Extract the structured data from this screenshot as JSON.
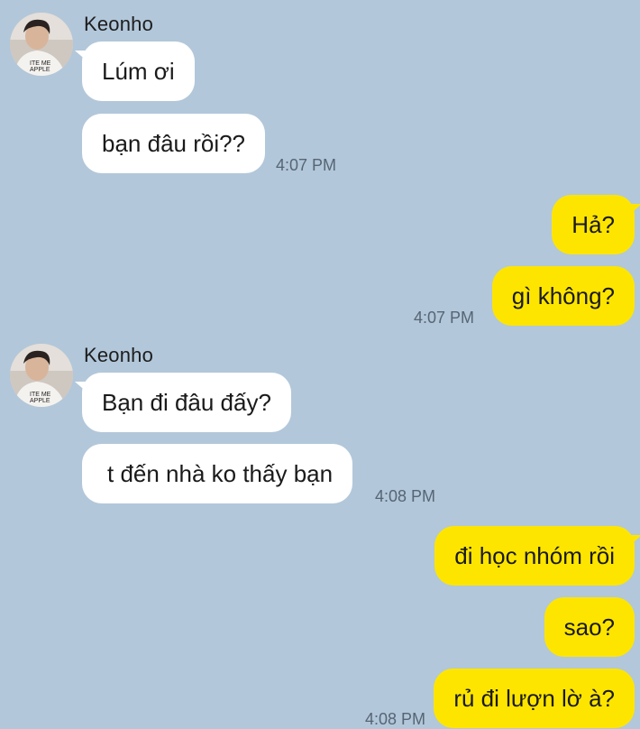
{
  "conversation": {
    "groups": [
      {
        "direction": "incoming",
        "sender": "Keonho",
        "avatar_icon": "profile-photo-icon",
        "messages": [
          "Lúm ơi",
          "bạn đâu rồi??"
        ],
        "time": "4:07 PM"
      },
      {
        "direction": "outgoing",
        "messages": [
          "Hả?",
          "gì không?"
        ],
        "time": "4:07 PM"
      },
      {
        "direction": "incoming",
        "sender": "Keonho",
        "avatar_icon": "profile-photo-icon",
        "messages": [
          "Bạn đi đâu đấy?",
          "t đến nhà ko thấy bạn"
        ],
        "time": "4:08 PM"
      },
      {
        "direction": "outgoing",
        "messages": [
          "đi học nhóm rồi",
          "sao?",
          "rủ đi lượn lờ à?"
        ],
        "time": "4:08 PM"
      }
    ]
  },
  "colors": {
    "background": "#b2c7da",
    "incoming_bubble": "#ffffff",
    "outgoing_bubble": "#fee500",
    "timestamp": "#566574"
  }
}
